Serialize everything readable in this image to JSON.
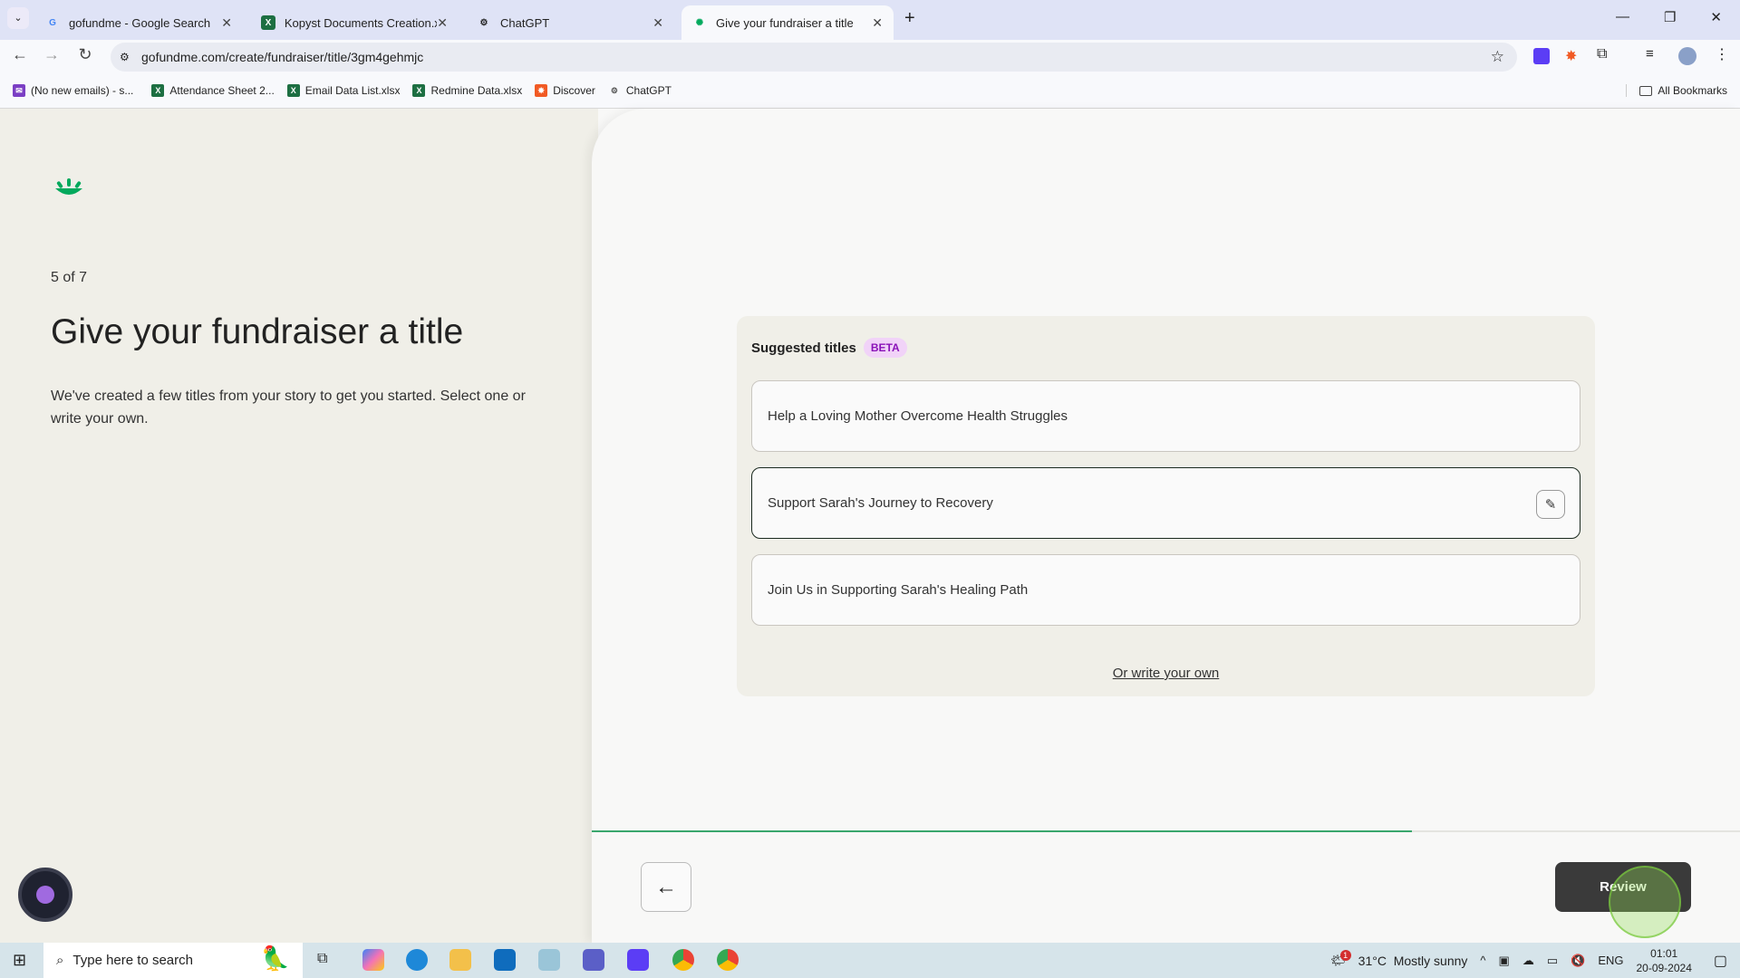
{
  "browser": {
    "tabs": [
      {
        "label": "gofundme - Google Search",
        "icon": "google-icon"
      },
      {
        "label": "Kopyst Documents Creation.xlsx",
        "icon": "excel-icon"
      },
      {
        "label": "ChatGPT",
        "icon": "chatgpt-icon"
      },
      {
        "label": "Give your fundraiser a title",
        "icon": "gofundme-icon",
        "active": true
      }
    ],
    "url": "gofundme.com/create/fundraiser/title/3gm4gehmjc",
    "bookmarks": [
      {
        "label": "(No new emails) - s...",
        "icon": "mail-icon"
      },
      {
        "label": "Attendance Sheet 2...",
        "icon": "excel-icon"
      },
      {
        "label": "Email Data List.xlsx",
        "icon": "excel-icon"
      },
      {
        "label": "Redmine Data.xlsx",
        "icon": "excel-icon"
      },
      {
        "label": "Discover",
        "icon": "discover-icon"
      },
      {
        "label": "ChatGPT",
        "icon": "chatgpt-icon"
      }
    ],
    "all_bookmarks": "All Bookmarks"
  },
  "page": {
    "step": "5 of 7",
    "title": "Give your fundraiser a title",
    "description": "We've created a few titles from your story to get you started. Select one or write your own.",
    "suggested_heading": "Suggested titles",
    "beta": "BETA",
    "options": [
      "Help a Loving Mother Overcome Health Struggles",
      "Support Sarah's Journey to Recovery",
      "Join Us in Supporting Sarah's Healing Path"
    ],
    "selected_index": 1,
    "write_own": "Or write your own",
    "progress_fraction": 0.714,
    "back_icon": "arrow-left-icon",
    "review_label": "Review",
    "brand_color": "#02a95c"
  },
  "taskbar": {
    "search_placeholder": "Type here to search",
    "weather": "31°C  Mostly sunny",
    "weather_badge": "1",
    "lang": "ENG",
    "time": "01:01",
    "date": "20-09-2024"
  }
}
